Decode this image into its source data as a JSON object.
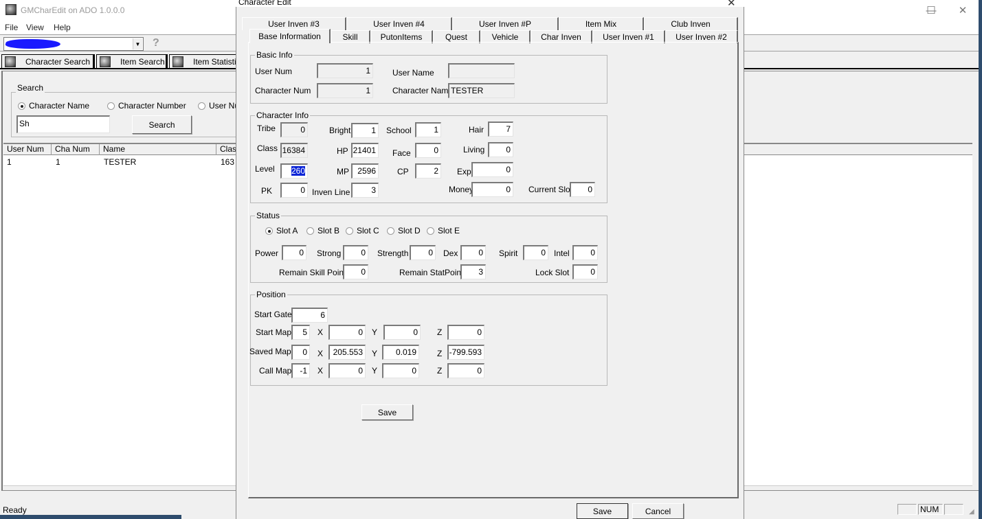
{
  "main_window": {
    "title": "GMCharEdit on ADO 1.0.0.0",
    "controls": {
      "minimize": "—",
      "maximize": "☐",
      "close": "✕"
    },
    "menu": [
      "File",
      "View",
      "Help"
    ],
    "toolbar": {
      "help_icon": "?"
    },
    "tabs": [
      {
        "label": "Character Search",
        "icon": "gear-icon"
      },
      {
        "label": "Item Search",
        "icon": "gear-icon"
      },
      {
        "label": "Item Statistic",
        "icon": "gear-icon"
      }
    ],
    "search": {
      "group_label": "Search",
      "options": [
        {
          "label": "Character Name",
          "selected": true
        },
        {
          "label": "Character Number",
          "selected": false
        },
        {
          "label": "User Nu",
          "selected": false
        }
      ],
      "input_value": "Sh",
      "button_label": "Search"
    },
    "results": {
      "columns": [
        "User Num",
        "Cha Num",
        "Name",
        "Class"
      ],
      "rows": [
        {
          "user_num": "1",
          "cha_num": "1",
          "name": "TESTER",
          "class": "163"
        }
      ]
    },
    "status": {
      "text": "Ready",
      "num_indicator": "NUM"
    }
  },
  "dialog": {
    "title": "Character Edit",
    "close": "✕",
    "tabs_row1": [
      "User Inven #3",
      "User Inven #4",
      "User Inven #P",
      "Item Mix",
      "Club Inven"
    ],
    "tabs_row2": [
      "Base Information",
      "Skill",
      "PutonItems",
      "Quest",
      "Vehicle",
      "Char Inven",
      "User Inven #1",
      "User Inven #2"
    ],
    "active_tab": "Base Information",
    "basic_info": {
      "title": "Basic Info",
      "user_num": {
        "label": "User Num",
        "value": "1"
      },
      "user_name": {
        "label": "User Name",
        "value": ""
      },
      "character_num": {
        "label": "Character Num",
        "value": "1"
      },
      "character_name": {
        "label": "Character Name",
        "value": "TESTER"
      }
    },
    "character_info": {
      "title": "Character Info",
      "tribe": {
        "label": "Tribe",
        "value": "0"
      },
      "class": {
        "label": "Class",
        "value": "16384"
      },
      "level": {
        "label": "Level",
        "value": "260"
      },
      "pk": {
        "label": "PK",
        "value": "0"
      },
      "bright": {
        "label": "Bright",
        "value": "1"
      },
      "hp": {
        "label": "HP",
        "value": "21401"
      },
      "mp": {
        "label": "MP",
        "value": "2596"
      },
      "inven_line": {
        "label": "Inven Line",
        "value": "3"
      },
      "school": {
        "label": "School",
        "value": "1"
      },
      "face": {
        "label": "Face",
        "value": "0"
      },
      "cp": {
        "label": "CP",
        "value": "2"
      },
      "hair": {
        "label": "Hair",
        "value": "7"
      },
      "living": {
        "label": "Living",
        "value": "0"
      },
      "exp": {
        "label": "Exp",
        "value": "0"
      },
      "money": {
        "label": "Money",
        "value": "0"
      },
      "current_slot": {
        "label": "Current Slot",
        "value": "0"
      }
    },
    "status": {
      "title": "Status",
      "slots": [
        {
          "label": "Slot A",
          "selected": true
        },
        {
          "label": "Slot B",
          "selected": false
        },
        {
          "label": "Slot C",
          "selected": false
        },
        {
          "label": "Slot D",
          "selected": false
        },
        {
          "label": "Slot E",
          "selected": false
        }
      ],
      "power": {
        "label": "Power",
        "value": "0"
      },
      "strong": {
        "label": "Strong",
        "value": "0"
      },
      "strength": {
        "label": "Strength",
        "value": "0"
      },
      "dex": {
        "label": "Dex",
        "value": "0"
      },
      "spirit": {
        "label": "Spirit",
        "value": "0"
      },
      "intel": {
        "label": "Intel",
        "value": "0"
      },
      "remain_skill_point": {
        "label": "Remain Skill Point",
        "value": "0"
      },
      "remain_stat_point": {
        "label": "Remain StatPoint",
        "value": "3"
      },
      "lock_slot": {
        "label": "Lock Slot",
        "value": "0"
      }
    },
    "position": {
      "title": "Position",
      "start_gate": {
        "label": "Start Gate",
        "value": "6"
      },
      "axis_labels": {
        "x": "X",
        "y": "Y",
        "z": "Z"
      },
      "start_map": {
        "label": "Start Map",
        "map": "5",
        "x": "0",
        "y": "0",
        "z": "0"
      },
      "saved_map": {
        "label": "Saved Map",
        "map": "0",
        "x": "205.553",
        "y": "0.019",
        "z": "-799.593"
      },
      "call_map": {
        "label": "Call Map",
        "map": "-1",
        "x": "0",
        "y": "0",
        "z": "0"
      }
    },
    "inner_save_label": "Save",
    "save_label": "Save",
    "cancel_label": "Cancel"
  }
}
